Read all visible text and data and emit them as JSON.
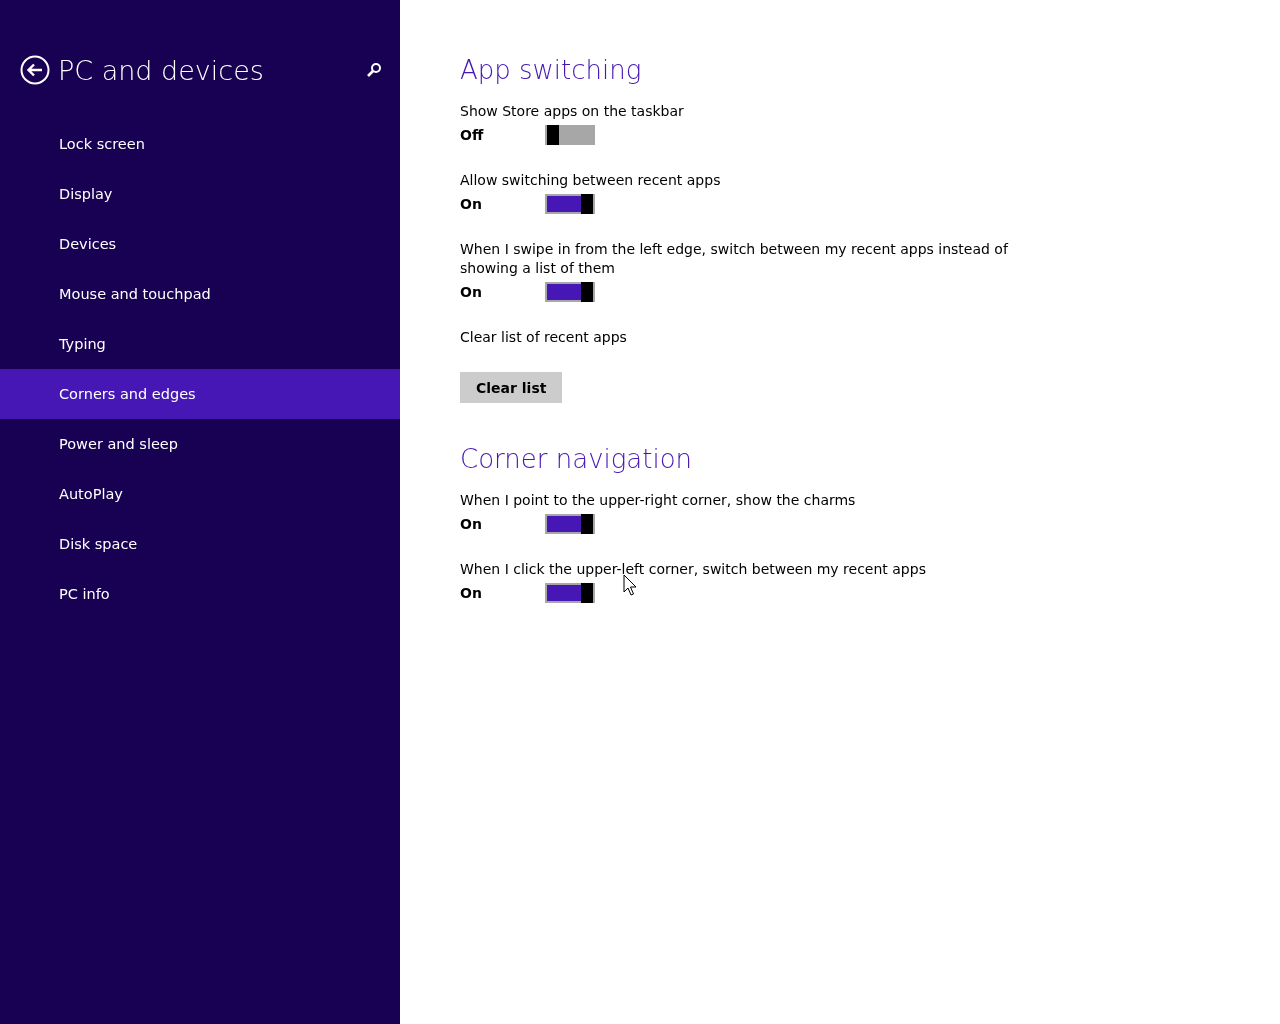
{
  "sidebar": {
    "title": "PC and devices",
    "items": [
      {
        "label": "Lock screen",
        "selected": false
      },
      {
        "label": "Display",
        "selected": false
      },
      {
        "label": "Devices",
        "selected": false
      },
      {
        "label": "Mouse and touchpad",
        "selected": false
      },
      {
        "label": "Typing",
        "selected": false
      },
      {
        "label": "Corners and edges",
        "selected": true
      },
      {
        "label": "Power and sleep",
        "selected": false
      },
      {
        "label": "AutoPlay",
        "selected": false
      },
      {
        "label": "Disk space",
        "selected": false
      },
      {
        "label": "PC info",
        "selected": false
      }
    ]
  },
  "sections": [
    {
      "heading": "App switching",
      "settings": [
        {
          "kind": "toggle",
          "label": "Show Store apps on the taskbar",
          "state": "Off",
          "on": false
        },
        {
          "kind": "toggle",
          "label": "Allow switching between recent apps",
          "state": "On",
          "on": true
        },
        {
          "kind": "toggle",
          "label": "When I swipe in from the left edge, switch between my recent apps instead of showing a list of them",
          "state": "On",
          "on": true
        },
        {
          "kind": "button",
          "label": "Clear list of recent apps",
          "button": "Clear list"
        }
      ]
    },
    {
      "heading": "Corner navigation",
      "settings": [
        {
          "kind": "toggle",
          "label": "When I point to the upper-right corner, show the charms",
          "state": "On",
          "on": true
        },
        {
          "kind": "toggle",
          "label": "When I click the upper-left corner, switch between my recent apps",
          "state": "On",
          "on": true
        }
      ]
    }
  ]
}
